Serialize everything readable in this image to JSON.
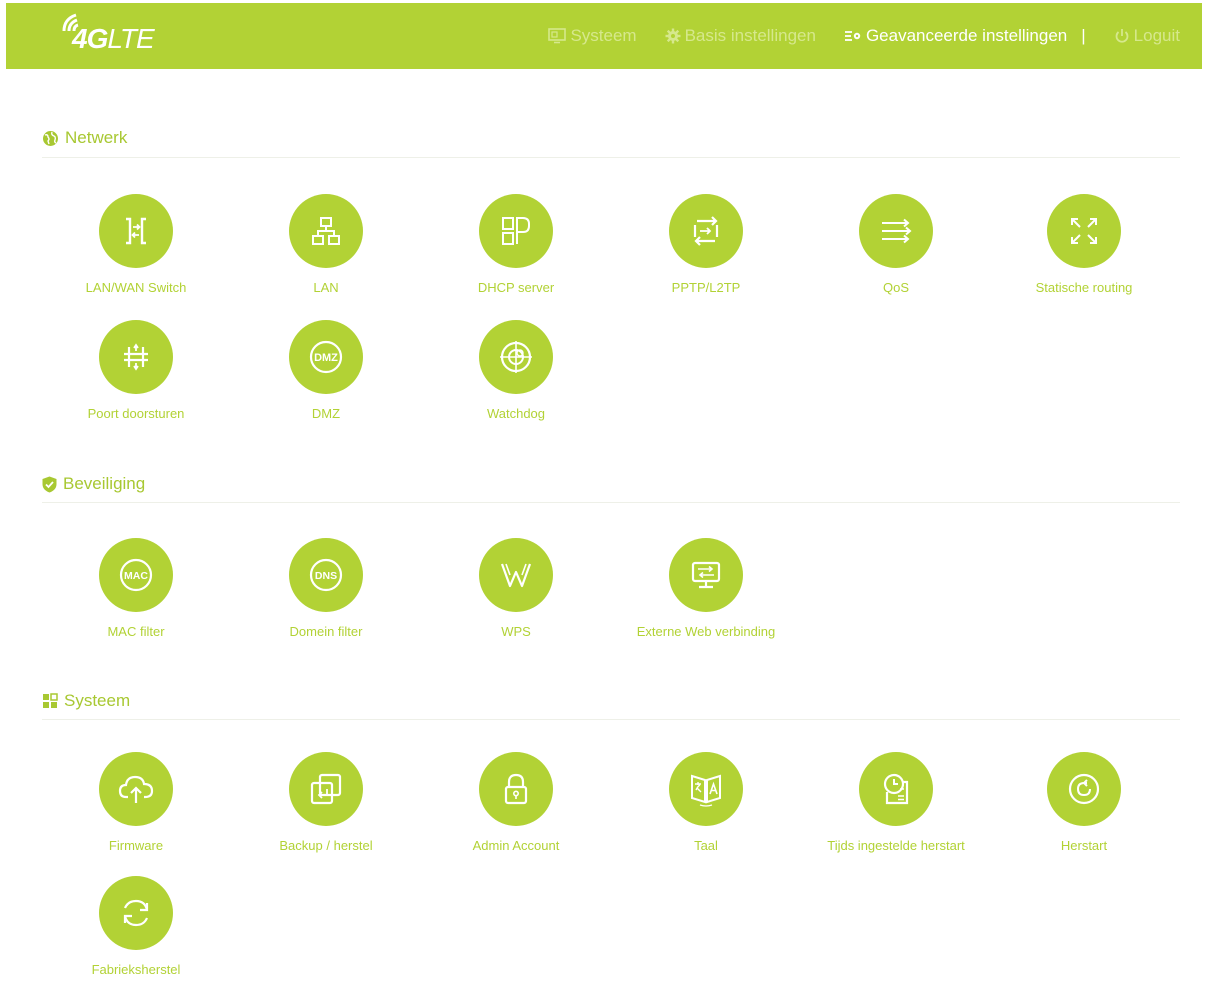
{
  "brand": {
    "logo_text_bold": "4G",
    "logo_text_light": "LTE"
  },
  "nav": {
    "systeem": "Systeem",
    "basis": "Basis instellingen",
    "geavanceerd": "Geavanceerde instellingen",
    "separator": "|",
    "loguit": "Loguit"
  },
  "sections": {
    "netwerk": {
      "title": "Netwerk",
      "items": [
        "LAN/WAN Switch",
        "LAN",
        "DHCP server",
        "PPTP/L2TP",
        "QoS",
        "Statische routing",
        "Poort doorsturen",
        "DMZ",
        "Watchdog"
      ]
    },
    "beveiliging": {
      "title": "Beveiliging",
      "items": [
        "MAC filter",
        "Domein filter",
        "WPS",
        "Externe Web verbinding"
      ]
    },
    "systeem": {
      "title": "Systeem",
      "items": [
        "Firmware",
        "Backup / herstel",
        "Admin Account",
        "Taal",
        "Tijds ingestelde herstart",
        "Herstart",
        "Fabrieksherstel"
      ]
    }
  },
  "icon_badges": {
    "dmz": "DMZ",
    "mac": "MAC",
    "dns": "DNS"
  },
  "colors": {
    "accent": "#b2d235",
    "nav_inactive": "#d6e88c",
    "white": "#ffffff"
  }
}
